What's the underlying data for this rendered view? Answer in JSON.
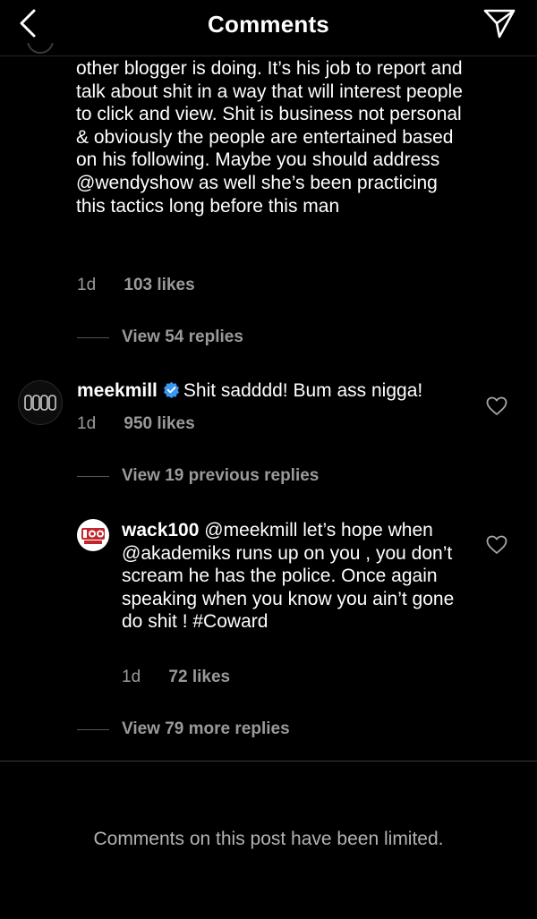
{
  "header": {
    "title": "Comments",
    "back_icon": "chevron-left-icon",
    "share_icon": "paper-plane-icon"
  },
  "comments": [
    {
      "text": "other blogger is doing. It’s his job to report and talk about shit in a way that will interest people to click and view. Shit is business not personal & obviously the people are entertained based on his following. Maybe you should address @wendyshow as well she’s been practicing this tactics long before this man",
      "time": "1d",
      "likes": "103 likes",
      "view_replies": "View 54 replies"
    },
    {
      "username": "meekmill",
      "verified": true,
      "text": "Shit sadddd! Bum ass nigga!",
      "time": "1d",
      "likes": "950 likes",
      "view_previous": "View 19 previous replies",
      "reply": {
        "username": "wack100",
        "text": "@meekmill let’s hope when @akademiks runs up on you , you don’t scream he has the police. Once again speaking when you know you ain’t gone do shit ! #Coward",
        "time": "1d",
        "likes": "72 likes"
      },
      "view_more": "View 79 more replies"
    }
  ],
  "footer": {
    "limited_text": "Comments on this post have been limited."
  },
  "colors": {
    "background": "#000000",
    "secondary_text": "#9a9a9a",
    "verified_blue": "#3897f0",
    "wack_red": "#c0272d"
  }
}
